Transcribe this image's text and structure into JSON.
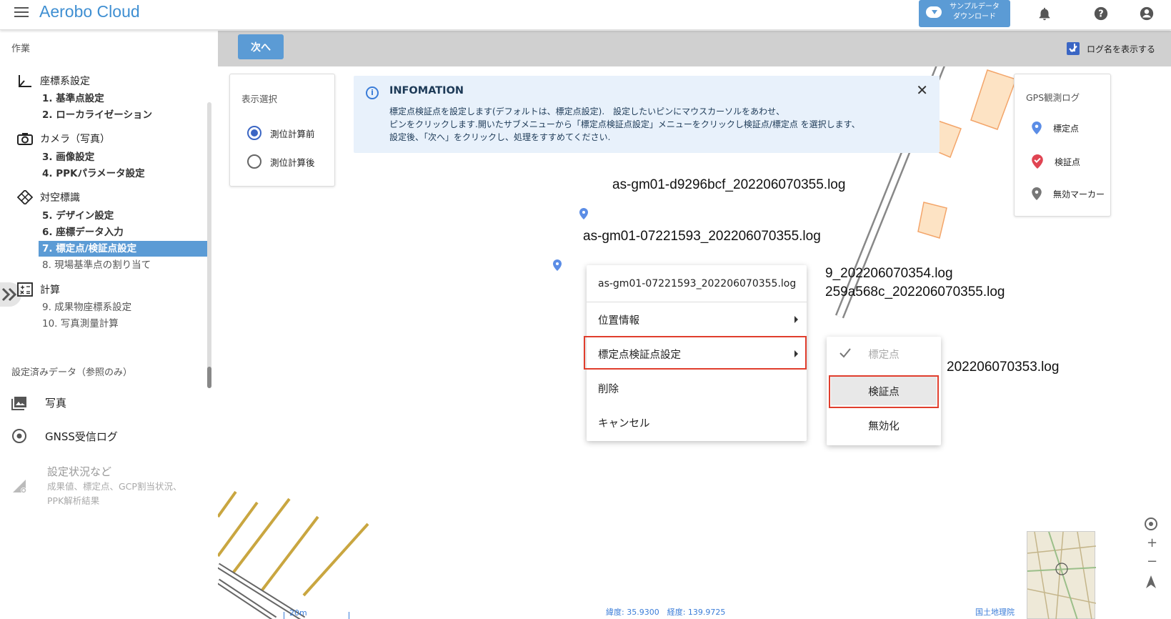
{
  "app": {
    "title": "Aerobo Cloud",
    "download_btn": [
      "サンプルデータ",
      "ダウンロード"
    ]
  },
  "sidebar": {
    "work_title": "作業",
    "sections": [
      {
        "label": "座標系設定",
        "icon": "axis-icon",
        "items": [
          "1. 基準点設定",
          "2. ローカライゼーション"
        ]
      },
      {
        "label": "カメラ（写真）",
        "icon": "camera-icon",
        "items": [
          "3. 画像設定",
          "4. PPKパラメータ設定"
        ]
      },
      {
        "label": "対空標識",
        "icon": "target-diamond-icon",
        "items": [
          "5. デザイン設定",
          "6. 座標データ入力",
          "7. 標定点/検証点設定",
          "8. 現場基準点の割り当て"
        ]
      },
      {
        "label": "計算",
        "icon": "calculator-icon",
        "items": [
          "9. 成果物座標系設定",
          "10. 写真測量計算"
        ]
      }
    ],
    "active_item": "7. 標定点/検証点設定",
    "ref_title": "設定済みデータ（参照のみ）",
    "ref_items": [
      {
        "label": "写真",
        "icon": "photo-icon"
      },
      {
        "label": "GNSS受信ログ",
        "icon": "gnss-icon"
      }
    ],
    "status_title": "設定状況など",
    "status_desc": [
      "成果値、標定点、GCP割当状況、",
      "PPK解析結果"
    ]
  },
  "toolbar": {
    "next_label": "次へ",
    "show_logname_label": "ログ名を表示する",
    "show_logname_checked": true
  },
  "display_select": {
    "title": "表示選択",
    "options": [
      "測位計算前",
      "測位計算後"
    ],
    "selected": "測位計算前"
  },
  "info": {
    "title": "INFOMATION",
    "lines": [
      "標定点検証点を設定します(デフォルトは、標定点設定).　設定したいピンにマウスカーソルをあわせ、",
      "ピンをクリックします.開いたサブメニューから「標定点検証点設定」メニューをクリックし検証点/標定点 を選択します、",
      "設定後、「次へ」をクリックし、処理をすすめてください."
    ]
  },
  "map_labels": [
    "as-gm01-d9296bcf_202206070355.log",
    "as-gm01-07221593_202206070355.log",
    "9_202206070354.log",
    "259a568c_202206070355.log",
    "202206070353.log"
  ],
  "context_menu": {
    "header": "as-gm01-07221593_202206070355.log",
    "items": [
      "位置情報",
      "標定点検証点設定",
      "削除",
      "キャンセル"
    ]
  },
  "submenu": {
    "items": [
      "標定点",
      "検証点",
      "無効化"
    ],
    "checked": "標定点"
  },
  "legend": {
    "title": "GPS観測ログ",
    "items": [
      {
        "label": "標定点",
        "color": "#5b8de6",
        "icon": "pin-blue-icon"
      },
      {
        "label": "検証点",
        "color": "#e04452",
        "icon": "pin-check-icon"
      },
      {
        "label": "無効マーカー",
        "color": "#777777",
        "icon": "pin-gray-icon"
      }
    ]
  },
  "footer": {
    "scale": "20m",
    "coords": "緯度: 35.9300　経度: 139.9725",
    "attribution": "国土地理院"
  }
}
